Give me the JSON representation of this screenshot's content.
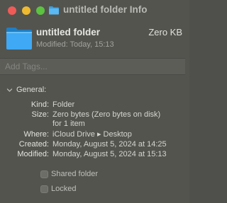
{
  "window": {
    "title": "untitled folder Info"
  },
  "header": {
    "name": "untitled folder",
    "size": "Zero KB",
    "modified": "Modified: Today, 15:13",
    "icon": "folder-icon"
  },
  "tags": {
    "placeholder": "Add Tags..."
  },
  "general": {
    "label": "General:",
    "kind_key": "Kind:",
    "kind_value": "Folder",
    "size_key": "Size:",
    "size_value": "Zero bytes (Zero bytes on disk)",
    "size_items": "for 1 item",
    "where_key": "Where:",
    "where_value": "iCloud Drive ▸ Desktop",
    "created_key": "Created:",
    "created_value": "Monday, August 5, 2024 at 14:25",
    "modified_key": "Modified:",
    "modified_value": "Monday, August 5, 2024 at 15:13"
  },
  "options": {
    "shared_folder": "Shared folder",
    "locked": "Locked",
    "shared_checked": false,
    "locked_checked": false
  },
  "colors": {
    "accent_folder": "#3fa9f5",
    "close": "#f05b57",
    "minimize": "#efba2f",
    "zoom": "#5bc33f"
  }
}
